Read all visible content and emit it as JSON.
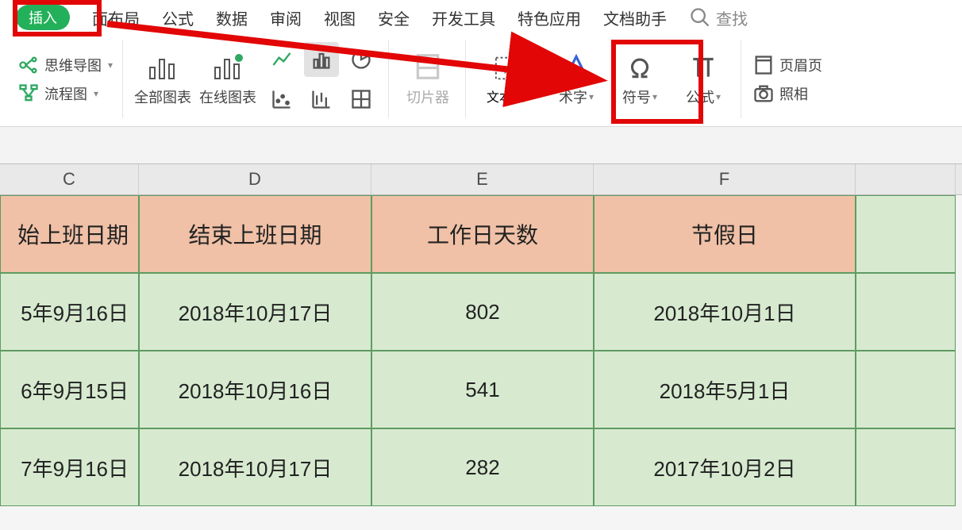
{
  "tabs": {
    "insert": "插入",
    "layout": "面布局",
    "formula": "公式",
    "data": "数据",
    "review": "审阅",
    "view": "视图",
    "security": "安全",
    "devtools": "开发工具",
    "special": "特色应用",
    "dochelper": "文档助手",
    "find": "查找"
  },
  "ribbon": {
    "mindmap": "思维导图",
    "flowchart": "流程图",
    "allcharts": "全部图表",
    "onlinecharts": "在线图表",
    "slicer": "切片器",
    "textbox": "文本框",
    "wordart": "术字",
    "symbol": "符号",
    "equation": "公式",
    "header_footer": "页眉页",
    "camera": "照相"
  },
  "columns": {
    "c": "C",
    "d": "D",
    "e": "E",
    "f": "F"
  },
  "headers": {
    "c": "始上班日期",
    "d": "结束上班日期",
    "e": "工作日天数",
    "f": "节假日"
  },
  "rows": [
    {
      "c": "5年9月16日",
      "d": "2018年10月17日",
      "e": "802",
      "f": "2018年10月1日"
    },
    {
      "c": "6年9月15日",
      "d": "2018年10月16日",
      "e": "541",
      "f": "2018年5月1日"
    },
    {
      "c": "7年9月16日",
      "d": "2018年10月17日",
      "e": "282",
      "f": "2017年10月2日"
    }
  ]
}
